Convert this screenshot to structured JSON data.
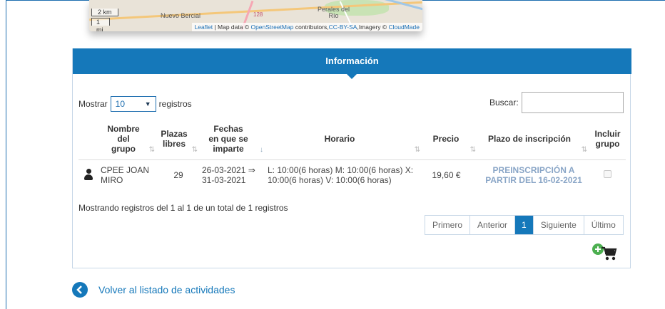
{
  "map": {
    "scale_km": "2 km",
    "scale_mi": "1 mi",
    "place_1": "Nuevo Bercial",
    "place_2": "Perales del",
    "place_2b": "Río",
    "road_label": "128",
    "attribution": {
      "leaflet": "Leaflet",
      "sep1": " | Map data © ",
      "osm": "OpenStreetMap",
      "contrib": " contributors,",
      "license": "CC-BY-SA",
      "imagery": ",Imagery © ",
      "cloudmade": "CloudMade"
    }
  },
  "panel": {
    "title": "Información",
    "length": {
      "prefix": "Mostrar",
      "value": "10",
      "suffix": "registros"
    },
    "search_label": "Buscar:",
    "columns": {
      "nombre_l1": "Nombre",
      "nombre_l2": "del",
      "nombre_l3": "grupo",
      "plazas_l1": "Plazas",
      "plazas_l2": "libres",
      "fechas_l1": "Fechas",
      "fechas_l2": "en que se",
      "fechas_l3": "imparte",
      "horario": "Horario",
      "precio": "Precio",
      "plazo": "Plazo de inscripción",
      "incluir_l1": "Incluir",
      "incluir_l2": "grupo"
    },
    "rows": [
      {
        "nombre_l1": "CPEE JOAN",
        "nombre_l2": "MIRO",
        "plazas": "29",
        "fechas_l1": "26-03-2021 ⇒",
        "fechas_l2": "31-03-2021",
        "horario_l1": "L: 10:00(6 horas) M: 10:00(6 horas) X:",
        "horario_l2": "10:00(6 horas) V: 10:00(6 horas)",
        "precio": "19,60 €",
        "plazo_l1": "PREINSCRIPCIÓN A",
        "plazo_l2": "PARTIR DEL 16-02-2021"
      }
    ],
    "info": "Mostrando registros del 1 al 1 de un total de 1 registros",
    "pager": {
      "first": "Primero",
      "prev": "Anterior",
      "current": "1",
      "next": "Siguiente",
      "last": "Último"
    }
  },
  "back_link": "Volver al listado de actividades",
  "colors": {
    "brand_blue": "#1578ba",
    "cart_green": "#4caf50"
  }
}
